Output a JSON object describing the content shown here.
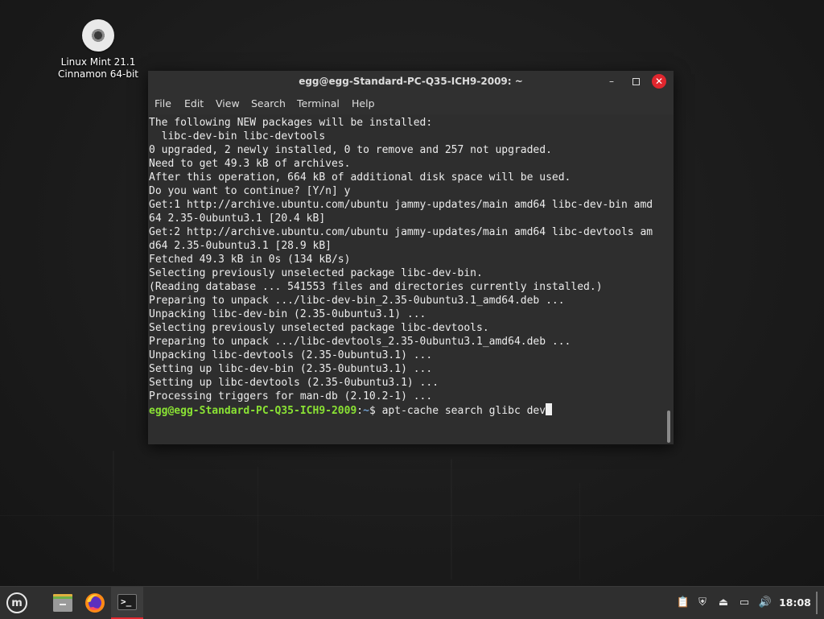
{
  "desktop": {
    "icon_label_line1": "Linux Mint 21.1",
    "icon_label_line2": "Cinnamon 64-bit",
    "icon": "optical-disc-icon"
  },
  "window": {
    "title": "egg@egg-Standard-PC-Q35-ICH9-2009: ~",
    "minimize_glyph": "–",
    "close_glyph": "✕",
    "menu": [
      "File",
      "Edit",
      "View",
      "Search",
      "Terminal",
      "Help"
    ]
  },
  "terminal": {
    "lines": [
      "The following NEW packages will be installed:",
      "  libc-dev-bin libc-devtools",
      "0 upgraded, 2 newly installed, 0 to remove and 257 not upgraded.",
      "Need to get 49.3 kB of archives.",
      "After this operation, 664 kB of additional disk space will be used.",
      "Do you want to continue? [Y/n] y",
      "Get:1 http://archive.ubuntu.com/ubuntu jammy-updates/main amd64 libc-dev-bin amd",
      "64 2.35-0ubuntu3.1 [20.4 kB]",
      "Get:2 http://archive.ubuntu.com/ubuntu jammy-updates/main amd64 libc-devtools am",
      "d64 2.35-0ubuntu3.1 [28.9 kB]",
      "Fetched 49.3 kB in 0s (134 kB/s)",
      "Selecting previously unselected package libc-dev-bin.",
      "(Reading database ... 541553 files and directories currently installed.)",
      "Preparing to unpack .../libc-dev-bin_2.35-0ubuntu3.1_amd64.deb ...",
      "Unpacking libc-dev-bin (2.35-0ubuntu3.1) ...",
      "Selecting previously unselected package libc-devtools.",
      "Preparing to unpack .../libc-devtools_2.35-0ubuntu3.1_amd64.deb ...",
      "Unpacking libc-devtools (2.35-0ubuntu3.1) ...",
      "Setting up libc-dev-bin (2.35-0ubuntu3.1) ...",
      "Setting up libc-devtools (2.35-0ubuntu3.1) ...",
      "Processing triggers for man-db (2.10.2-1) ..."
    ],
    "prompt_user": "egg@egg-Standard-PC-Q35-ICH9-2009",
    "prompt_sep": ":",
    "prompt_path": "~",
    "prompt_symbol": "$ ",
    "command": "apt-cache search glibc dev"
  },
  "taskbar": {
    "menu_glyph": "m",
    "terminal_glyph": ">_",
    "tray_glyphs": {
      "clipboard": "📋",
      "shield": "⛨",
      "eject": "⏏",
      "network": "▭",
      "volume": "🔊"
    },
    "clock": "18:08"
  },
  "colors": {
    "prompt_green": "#8ae234",
    "prompt_blue": "#729fcf",
    "close_red": "#e0262e"
  }
}
